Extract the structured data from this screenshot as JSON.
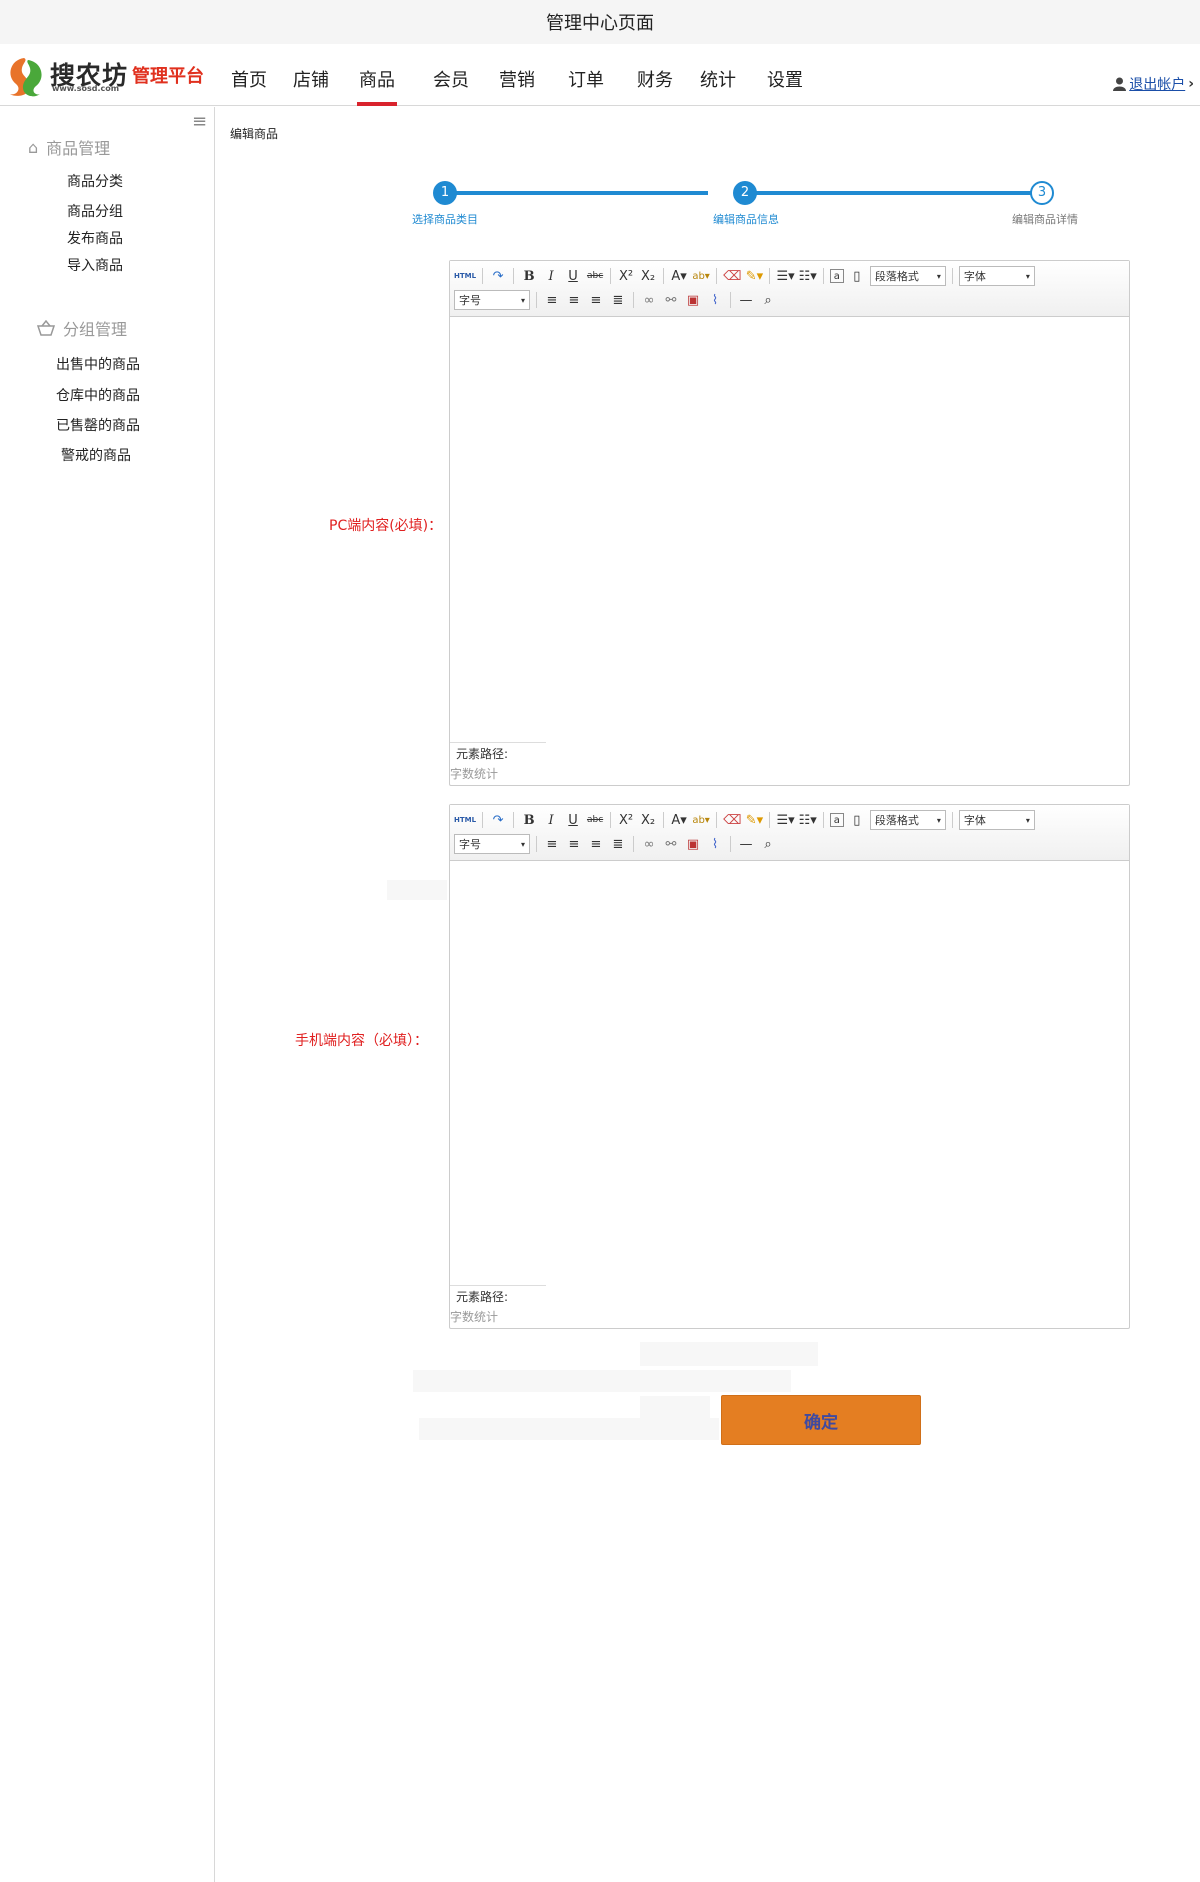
{
  "window": {
    "title": "管理中心页面"
  },
  "brand": {
    "name": "搜农坊",
    "url": "www.sosd.com",
    "platform": "管理平台"
  },
  "nav": {
    "items": [
      "首页",
      "店铺",
      "商品",
      "会员",
      "营销",
      "订单",
      "财务",
      "统计",
      "设置"
    ],
    "active_index": 2
  },
  "user": {
    "logout_label": "退出帐户"
  },
  "sidebar": {
    "groups": [
      {
        "title": "商品管理",
        "icon": "home-icon",
        "items": [
          "商品分类",
          "商品分组",
          "发布商品",
          "导入商品"
        ]
      },
      {
        "title": "分组管理",
        "icon": "basket-icon",
        "items": [
          "出售中的商品",
          "仓库中的商品",
          "已售罄的商品",
          "警戒的商品"
        ]
      }
    ]
  },
  "breadcrumb": "编辑商品",
  "steps": [
    {
      "number": "1",
      "label": "选择商品类目",
      "state": "done"
    },
    {
      "number": "2",
      "label": "编辑商品信息",
      "state": "current"
    },
    {
      "number": "3",
      "label": "编辑商品详情",
      "state": "todo"
    }
  ],
  "form": {
    "pc_label": "PC端内容(必填)：",
    "mobile_label": "手机端内容（必填）：",
    "submit_label": "确定"
  },
  "editor": {
    "html_btn": "HTML",
    "paragraph_select": "段落格式",
    "font_select": "字体",
    "size_select": "字号",
    "path_label": "元素路径:",
    "word_count_label": "字数统计"
  }
}
